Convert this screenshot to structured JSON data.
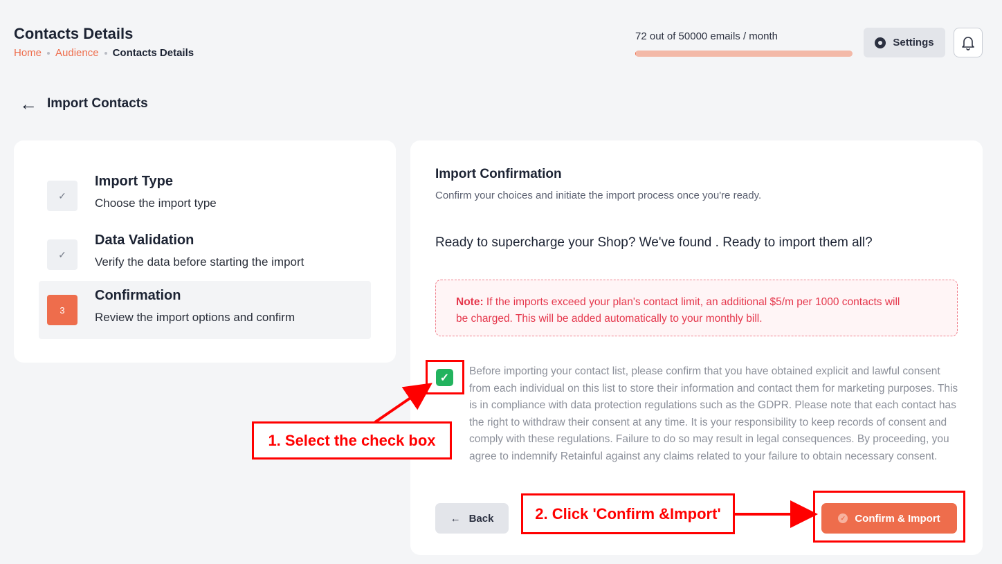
{
  "header": {
    "title": "Contacts Details",
    "breadcrumb": [
      "Home",
      "Audience",
      "Contacts Details"
    ],
    "usage_text": "72 out of 50000 emails / month",
    "usage_fraction": 0.00144,
    "settings_label": "Settings"
  },
  "import": {
    "title": "Import Contacts"
  },
  "steps": [
    {
      "number": "✓",
      "title": "Import Type",
      "desc": "Choose the import type",
      "state": "done"
    },
    {
      "number": "✓",
      "title": "Data Validation",
      "desc": "Verify the data before starting the import",
      "state": "done"
    },
    {
      "number": "3",
      "title": "Confirmation",
      "desc": "Review the import options and confirm",
      "state": "active"
    }
  ],
  "confirmation": {
    "title": "Import Confirmation",
    "subtitle": "Confirm your choices and initiate the import process once you're ready.",
    "question": "Ready to supercharge your Shop? We've found . Ready to import them all?",
    "note_label": "Note:",
    "note_text": " If the imports exceed your plan's contact limit, an additional $5/m per 1000 contacts will be charged. This will be added automatically to your monthly bill.",
    "consent_checked": true,
    "consent_text": "Before importing your contact list, please confirm that you have obtained explicit and lawful consent from each individual on this list to store their information and contact them for marketing purposes. This is in compliance with data protection regulations such as the GDPR. Please note that each contact has the right to withdraw their consent at any time. It is your responsibility to keep records of consent and comply with these regulations. Failure to do so may result in legal consequences. By proceeding, you agree to indemnify Retainful against any claims related to your failure to obtain necessary consent.",
    "back_label": "Back",
    "confirm_label": "Confirm & Import"
  },
  "annotations": {
    "step1": "1. Select the check box",
    "step2": "2. Click 'Confirm &Import'"
  },
  "colors": {
    "accent": "#ee6d4c",
    "annotation": "#ff0000",
    "check": "#22b35e",
    "note": "#e5374c"
  }
}
